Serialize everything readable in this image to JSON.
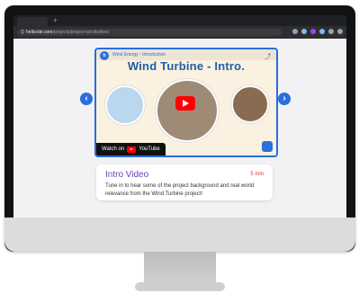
{
  "browser": {
    "url_host": "hellcode.com",
    "url_path": "/projects/project-windturbine"
  },
  "video": {
    "channel_text": "Wind Energy - Introduction",
    "title": "Wind Turbine - Intro.",
    "watch_on": "Watch on",
    "youtube": "YouTube"
  },
  "card": {
    "title": "Intro Video",
    "duration": "5 min",
    "description": "Tune in to hear some of the project background and real world relevance from the Wind Turbine project!"
  },
  "icons": {
    "left_arrow": "chevron-left-icon",
    "right_arrow": "chevron-right-icon",
    "share": "share-icon"
  },
  "colors": {
    "accent": "#2a6fdb",
    "title_purple": "#6b3fb6",
    "duration_red": "#d23b3b"
  }
}
